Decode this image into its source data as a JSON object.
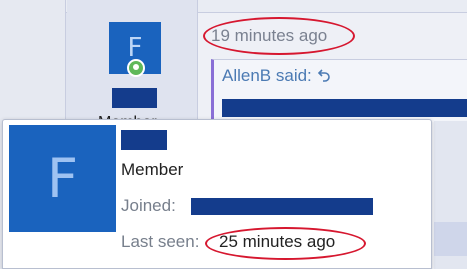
{
  "post": {
    "avatar_letter": "F",
    "timestamp": "19 minutes ago",
    "quote_author": "AllenB said:",
    "truncated_label": "Member"
  },
  "profile_popup": {
    "avatar_letter": "F",
    "role": "Member",
    "joined_label": "Joined:",
    "last_seen_label": "Last seen:",
    "last_seen_value": "25 minutes ago"
  },
  "colors": {
    "avatar_bg": "#1a63be",
    "redaction": "#143c8c",
    "highlight_ring": "#d6172f",
    "online_status": "#5fb85a",
    "quote_border": "#8a6fd6",
    "link": "#4b7ab3"
  },
  "icons": {
    "online": "online-status-icon",
    "reply": "reply-arrow-icon"
  }
}
